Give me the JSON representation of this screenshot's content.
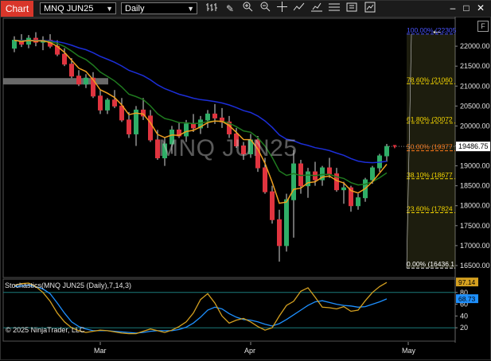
{
  "toolbar": {
    "tab_label": "Chart",
    "instrument": "MNQ JUN25",
    "interval": "Daily",
    "icons": [
      "bar-type-icon",
      "draw-pencil-icon",
      "zoom-in-icon",
      "zoom-out-icon",
      "crosshair-icon",
      "indicators-icon",
      "strategies-icon",
      "templates-icon",
      "chart-trader-icon"
    ],
    "window_buttons": {
      "minimize": "–",
      "maximize": "□",
      "close": "✕"
    }
  },
  "watermark": "MNQ JUN25",
  "copyright": "© 2025 NinjaTrader, LLC",
  "price_axis": {
    "ticks": [
      "22000.00",
      "21500.00",
      "21000.00",
      "20500.00",
      "20000.00",
      "19500.00",
      "19000.00",
      "18500.00",
      "18000.00",
      "17500.00",
      "17000.00",
      "16500.00"
    ],
    "last_price": "19486.75"
  },
  "fib_levels": [
    {
      "label": "100.00% (22305",
      "price": 22305,
      "color": "#4a55ff"
    },
    {
      "label": "78.60% (21060",
      "price": 21060,
      "color": "#f2d400"
    },
    {
      "label": "61.80% (20072",
      "price": 20072,
      "color": "#f2d400"
    },
    {
      "label": "50.00% (19377",
      "price": 19377,
      "color": "#ff7a1a"
    },
    {
      "label": "38.10% (18677",
      "price": 18677,
      "color": "#f2d400"
    },
    {
      "label": "23.60% (17824",
      "price": 17824,
      "color": "#f2d400"
    },
    {
      "label": "0.00% (16436.1",
      "price": 16436,
      "color": "#ffffff"
    }
  ],
  "oscillator": {
    "title": "Stochastics(MNQ JUN25 (Daily),7,14,3)",
    "ticks": [
      "80",
      "60",
      "40",
      "20"
    ],
    "k_value": "97.14",
    "d_value": "68.73",
    "k_color": "#d4a020",
    "d_color": "#1e90ff"
  },
  "date_axis": {
    "labels": [
      "Mar",
      "Apr",
      "May"
    ]
  },
  "chart_data": {
    "type": "candlestick",
    "y_range": [
      16200,
      22700
    ],
    "candles": [
      [
        21950,
        22250,
        21850,
        22150
      ],
      [
        22150,
        22300,
        21980,
        22050
      ],
      [
        22050,
        22280,
        21950,
        22200
      ],
      [
        22200,
        22350,
        22000,
        22100
      ],
      [
        22100,
        22250,
        21900,
        22150
      ],
      [
        22150,
        22300,
        21950,
        22000
      ],
      [
        22000,
        22150,
        21750,
        21800
      ],
      [
        21800,
        21950,
        21500,
        21550
      ],
      [
        21550,
        21700,
        21200,
        21250
      ],
      [
        21250,
        21400,
        21000,
        21050
      ],
      [
        21050,
        21300,
        20950,
        21200
      ],
      [
        21200,
        21350,
        20700,
        20750
      ],
      [
        20750,
        20900,
        20300,
        20400
      ],
      [
        20400,
        20700,
        20300,
        20650
      ],
      [
        20650,
        20900,
        20450,
        20500
      ],
      [
        20500,
        20700,
        20100,
        20150
      ],
      [
        20150,
        20350,
        19700,
        19800
      ],
      [
        19800,
        20500,
        19500,
        20400
      ],
      [
        20400,
        20700,
        20150,
        20250
      ],
      [
        20250,
        20400,
        19600,
        19650
      ],
      [
        19650,
        19900,
        19150,
        19200
      ],
      [
        19200,
        19700,
        19000,
        19550
      ],
      [
        19550,
        20000,
        19300,
        19900
      ],
      [
        19900,
        20100,
        19700,
        19750
      ],
      [
        19750,
        20150,
        19600,
        20050
      ],
      [
        20050,
        20300,
        19850,
        19950
      ],
      [
        19950,
        20250,
        19800,
        20150
      ],
      [
        20150,
        20400,
        19950,
        20300
      ],
      [
        20300,
        20550,
        20050,
        20200
      ],
      [
        20200,
        20450,
        19950,
        20100
      ],
      [
        20100,
        20250,
        19700,
        19800
      ],
      [
        19800,
        19950,
        19450,
        19500
      ],
      [
        19500,
        19600,
        19150,
        19300
      ],
      [
        19300,
        19800,
        19200,
        19650
      ],
      [
        19650,
        19750,
        18850,
        18950
      ],
      [
        18950,
        19200,
        18300,
        18350
      ],
      [
        18350,
        18500,
        17550,
        17650
      ],
      [
        17650,
        17900,
        16600,
        17000
      ],
      [
        17000,
        18300,
        16850,
        18150
      ],
      [
        18150,
        19400,
        17200,
        19050
      ],
      [
        19050,
        19150,
        18300,
        18500
      ],
      [
        18500,
        18950,
        18200,
        18850
      ],
      [
        18850,
        19100,
        18500,
        18650
      ],
      [
        18650,
        19000,
        18500,
        18950
      ],
      [
        18950,
        19200,
        18700,
        18800
      ],
      [
        18800,
        18950,
        18350,
        18400
      ],
      [
        18400,
        18600,
        18050,
        18450
      ],
      [
        18450,
        18500,
        17850,
        18000
      ],
      [
        18000,
        18300,
        17900,
        18200
      ],
      [
        18200,
        18700,
        18100,
        18650
      ],
      [
        18650,
        19000,
        18550,
        18950
      ],
      [
        18950,
        19300,
        18850,
        19250
      ],
      [
        19250,
        19550,
        19100,
        19487
      ]
    ]
  }
}
